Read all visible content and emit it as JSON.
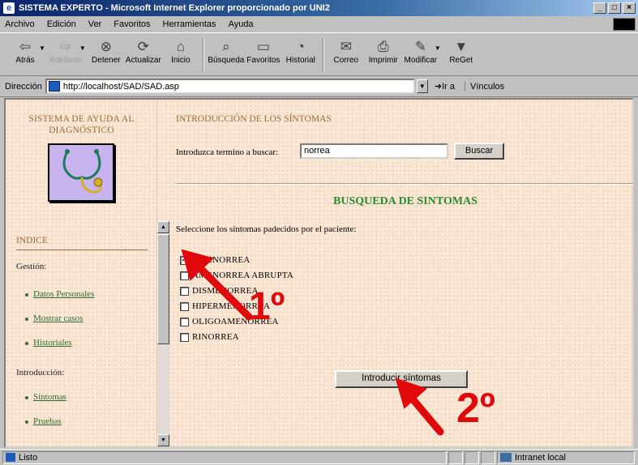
{
  "window": {
    "title": "SISTEMA EXPERTO - Microsoft Internet Explorer proporcionado por UNI2"
  },
  "menu": [
    {
      "label": "Archivo"
    },
    {
      "label": "Edición"
    },
    {
      "label": "Ver"
    },
    {
      "label": "Favoritos"
    },
    {
      "label": "Herramientas"
    },
    {
      "label": "Ayuda"
    }
  ],
  "toolbar": {
    "back": "Atrás",
    "forward": "Adelante",
    "stop": "Detener",
    "refresh": "Actualizar",
    "home": "Inicio",
    "search": "Búsqueda",
    "favorites": "Favoritos",
    "history": "Historial",
    "mail": "Correo",
    "print": "Imprimir",
    "edit": "Modificar",
    "reget": "ReGet"
  },
  "address": {
    "label": "Dirección",
    "url": "http://localhost/SAD/SAD.asp",
    "go": "Ir a",
    "links": "Vínculos"
  },
  "sidebar": {
    "title_line1": "SISTEMA DE AYUDA AL",
    "title_line2": "DIAGNÓSTICO",
    "indice": "INDICE",
    "gestion": "Gestión:",
    "gestion_items": [
      "Datos Personales",
      "Mostrar casos",
      "Historiales"
    ],
    "introduccion": "Introducción:",
    "introduccion_items": [
      "Sintomas",
      "Pruebas"
    ]
  },
  "main": {
    "title": "INTRODUCCIÓN DE LOS SÍNTOMAS",
    "search_label": "Introduzca termino a buscar:",
    "search_value": "norrea",
    "search_button": "Buscar",
    "results_heading": "BUSQUEDA DE SINTOMAS",
    "instruction": "Seleccione los síntomas padecidos por el paciente:",
    "symptoms": [
      {
        "label": "AMENORREA",
        "checked": true
      },
      {
        "label": "AMENORREA ABRUPTA",
        "checked": false
      },
      {
        "label": "DISMENORREA",
        "checked": false
      },
      {
        "label": "HIPERMENORREA",
        "checked": false
      },
      {
        "label": "OLIGOAMENORREA",
        "checked": false
      },
      {
        "label": "RINORREA",
        "checked": false
      }
    ],
    "submit_button": "Introducir síntomas"
  },
  "annotations": {
    "step1": "1º",
    "step2": "2º",
    "color": "#e0080a"
  },
  "status": {
    "text": "Listo",
    "zone": "Intranet local"
  }
}
